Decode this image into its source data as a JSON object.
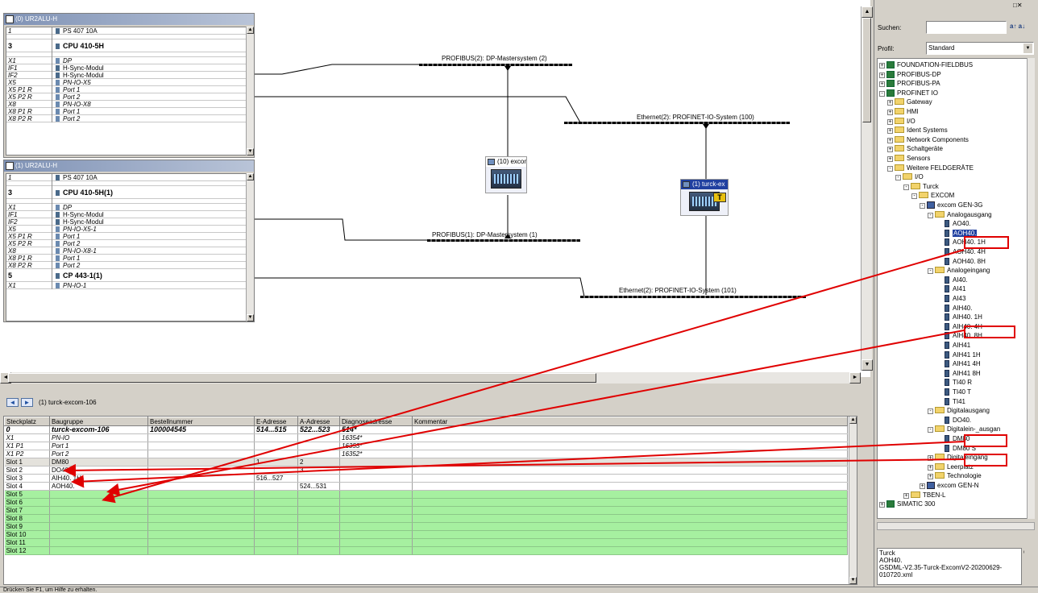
{
  "stations": [
    {
      "title": "(0) UR2ALU-H",
      "rows": [
        {
          "slot": "1",
          "module": "PS 407 10A",
          "type": "normal"
        },
        {
          "slot": "",
          "module": "",
          "type": "spacer"
        },
        {
          "slot": "3",
          "module": "CPU 410-5H",
          "type": "big"
        },
        {
          "slot": "",
          "module": "",
          "type": "spacer"
        },
        {
          "slot": "X1",
          "module": "DP",
          "type": "italic"
        },
        {
          "slot": "IF1",
          "module": "H-Sync-Modul",
          "type": "sub"
        },
        {
          "slot": "IF2",
          "module": "H-Sync-Modul",
          "type": "sub"
        },
        {
          "slot": "X5",
          "module": "PN-IO-X5",
          "type": "italic"
        },
        {
          "slot": "X5 P1 R",
          "module": "Port 1",
          "type": "italic"
        },
        {
          "slot": "X5 P2 R",
          "module": "Port 2",
          "type": "italic"
        },
        {
          "slot": "X8",
          "module": "PN-IO-X8",
          "type": "italic"
        },
        {
          "slot": "X8 P1 R",
          "module": "Port 1",
          "type": "italic"
        },
        {
          "slot": "X8 P2 R",
          "module": "Port 2",
          "type": "italic"
        }
      ]
    },
    {
      "title": "(1) UR2ALU-H",
      "rows": [
        {
          "slot": "1",
          "module": "PS 407 10A",
          "type": "normal"
        },
        {
          "slot": "",
          "module": "",
          "type": "spacer"
        },
        {
          "slot": "3",
          "module": "CPU 410-5H(1)",
          "type": "big"
        },
        {
          "slot": "",
          "module": "",
          "type": "spacer"
        },
        {
          "slot": "X1",
          "module": "DP",
          "type": "italic"
        },
        {
          "slot": "IF1",
          "module": "H-Sync-Modul",
          "type": "sub"
        },
        {
          "slot": "IF2",
          "module": "H-Sync-Modul",
          "type": "sub"
        },
        {
          "slot": "X5",
          "module": "PN-IO-X5-1",
          "type": "italic"
        },
        {
          "slot": "X5 P1 R",
          "module": "Port 1",
          "type": "italic"
        },
        {
          "slot": "X5 P2 R",
          "module": "Port 2",
          "type": "italic"
        },
        {
          "slot": "X8",
          "module": "PN-IO-X8-1",
          "type": "italic"
        },
        {
          "slot": "X8 P1 R",
          "module": "Port 1",
          "type": "italic"
        },
        {
          "slot": "X8 P2 R",
          "module": "Port 2",
          "type": "italic"
        },
        {
          "slot": "5",
          "module": "CP 443-1(1)",
          "type": "boldrow"
        },
        {
          "slot": "X1",
          "module": "PN-IO-1",
          "type": "italic"
        }
      ]
    }
  ],
  "buses": {
    "pb2": "PROFIBUS(2): DP-Mastersystem (2)",
    "pb1": "PROFIBUS(1): DP-Mastersystem (1)",
    "eth2_100": "Ethernet(2): PROFINET-IO-System (100)",
    "eth2_101": "Ethernet(2): PROFINET-IO-System (101)"
  },
  "nodes": {
    "excom": "(10) excom",
    "turck": "(1) turck-ex",
    "badge": "T"
  },
  "detail": {
    "title": "(1)  turck-excom-106",
    "columns": [
      "Steckplatz",
      "Baugruppe",
      "Bestellnummer",
      "E-Adresse",
      "A-Adresse",
      "Diagnoseadresse",
      "Kommentar"
    ],
    "rows": [
      {
        "slot": "0",
        "module": "turck-excom-106",
        "order": "100004545",
        "e": "514...515",
        "a": "522...523",
        "diag": "514*",
        "style": "bold"
      },
      {
        "slot": "X1",
        "module": "PN-IO",
        "order": "",
        "e": "",
        "a": "",
        "diag": "16354*",
        "style": "ital"
      },
      {
        "slot": "X1 P1",
        "module": "Port 1",
        "order": "",
        "e": "",
        "a": "",
        "diag": "16353*",
        "style": "ital"
      },
      {
        "slot": "X1 P2",
        "module": "Port 2",
        "order": "",
        "e": "",
        "a": "",
        "diag": "16352*",
        "style": "ital"
      },
      {
        "slot": "Slot 1",
        "module": "DM80",
        "order": "",
        "e": "1",
        "a": "2",
        "diag": "",
        "style": "sel"
      },
      {
        "slot": "Slot 2",
        "module": "DO40.",
        "order": "",
        "e": "",
        "a": "3",
        "diag": "",
        "style": "normal"
      },
      {
        "slot": "Slot 3",
        "module": "AIH40. 1H",
        "order": "",
        "e": "516...527",
        "a": "",
        "diag": "",
        "style": "normal"
      },
      {
        "slot": "Slot 4",
        "module": "AOH40.",
        "order": "",
        "e": "",
        "a": "524...531",
        "diag": "",
        "style": "normal"
      },
      {
        "slot": "Slot 5",
        "module": "",
        "order": "",
        "e": "",
        "a": "",
        "diag": "",
        "style": "green"
      },
      {
        "slot": "Slot 6",
        "module": "",
        "order": "",
        "e": "",
        "a": "",
        "diag": "",
        "style": "green"
      },
      {
        "slot": "Slot 7",
        "module": "",
        "order": "",
        "e": "",
        "a": "",
        "diag": "",
        "style": "green"
      },
      {
        "slot": "Slot 8",
        "module": "",
        "order": "",
        "e": "",
        "a": "",
        "diag": "",
        "style": "green"
      },
      {
        "slot": "Slot 9",
        "module": "",
        "order": "",
        "e": "",
        "a": "",
        "diag": "",
        "style": "green"
      },
      {
        "slot": "Slot 10",
        "module": "",
        "order": "",
        "e": "",
        "a": "",
        "diag": "",
        "style": "green"
      },
      {
        "slot": "Slot 11",
        "module": "",
        "order": "",
        "e": "",
        "a": "",
        "diag": "",
        "style": "green"
      },
      {
        "slot": "Slot 12",
        "module": "",
        "order": "",
        "e": "",
        "a": "",
        "diag": "",
        "style": "green"
      }
    ]
  },
  "catalog": {
    "search_label": "Suchen:",
    "search_value": "",
    "profile_label": "Profil:",
    "profile_value": "Standard",
    "tree": [
      {
        "d": 0,
        "pm": "+",
        "ic": "net",
        "t": "FOUNDATION-FIELDBUS"
      },
      {
        "d": 0,
        "pm": "+",
        "ic": "net",
        "t": "PROFIBUS-DP"
      },
      {
        "d": 0,
        "pm": "+",
        "ic": "net",
        "t": "PROFIBUS-PA"
      },
      {
        "d": 0,
        "pm": "-",
        "ic": "net",
        "t": "PROFINET IO"
      },
      {
        "d": 1,
        "pm": "+",
        "ic": "fold",
        "t": "Gateway"
      },
      {
        "d": 1,
        "pm": "+",
        "ic": "fold",
        "t": "HMI"
      },
      {
        "d": 1,
        "pm": "+",
        "ic": "fold",
        "t": "I/O"
      },
      {
        "d": 1,
        "pm": "+",
        "ic": "fold",
        "t": "Ident Systems"
      },
      {
        "d": 1,
        "pm": "+",
        "ic": "fold",
        "t": "Network Components"
      },
      {
        "d": 1,
        "pm": "+",
        "ic": "fold",
        "t": "Schaltgeräte"
      },
      {
        "d": 1,
        "pm": "+",
        "ic": "fold",
        "t": "Sensors"
      },
      {
        "d": 1,
        "pm": "-",
        "ic": "fold",
        "t": "Weitere FELDGERÄTE"
      },
      {
        "d": 2,
        "pm": "-",
        "ic": "fold",
        "t": "I/O"
      },
      {
        "d": 3,
        "pm": "-",
        "ic": "fold",
        "t": "Turck"
      },
      {
        "d": 4,
        "pm": "-",
        "ic": "fold",
        "t": "EXCOM"
      },
      {
        "d": 5,
        "pm": "-",
        "ic": "dev",
        "t": "excom GEN-3G"
      },
      {
        "d": 6,
        "pm": "-",
        "ic": "fold",
        "t": "Analogausgang"
      },
      {
        "d": 7,
        "pm": "",
        "ic": "mod",
        "t": "AO40."
      },
      {
        "d": 7,
        "pm": "",
        "ic": "mod",
        "t": "AOH40.",
        "sel": true
      },
      {
        "d": 7,
        "pm": "",
        "ic": "mod",
        "t": "AOH40. 1H"
      },
      {
        "d": 7,
        "pm": "",
        "ic": "mod",
        "t": "AOH40. 4H"
      },
      {
        "d": 7,
        "pm": "",
        "ic": "mod",
        "t": "AOH40. 8H"
      },
      {
        "d": 6,
        "pm": "-",
        "ic": "fold",
        "t": "Analogeingang"
      },
      {
        "d": 7,
        "pm": "",
        "ic": "mod",
        "t": "AI40."
      },
      {
        "d": 7,
        "pm": "",
        "ic": "mod",
        "t": "AI41"
      },
      {
        "d": 7,
        "pm": "",
        "ic": "mod",
        "t": "AI43"
      },
      {
        "d": 7,
        "pm": "",
        "ic": "mod",
        "t": "AIH40."
      },
      {
        "d": 7,
        "pm": "",
        "ic": "mod",
        "t": "AIH40. 1H"
      },
      {
        "d": 7,
        "pm": "",
        "ic": "mod",
        "t": "AIH40. 4H"
      },
      {
        "d": 7,
        "pm": "",
        "ic": "mod",
        "t": "AIH40. 8H"
      },
      {
        "d": 7,
        "pm": "",
        "ic": "mod",
        "t": "AIH41"
      },
      {
        "d": 7,
        "pm": "",
        "ic": "mod",
        "t": "AIH41 1H"
      },
      {
        "d": 7,
        "pm": "",
        "ic": "mod",
        "t": "AIH41 4H"
      },
      {
        "d": 7,
        "pm": "",
        "ic": "mod",
        "t": "AIH41 8H"
      },
      {
        "d": 7,
        "pm": "",
        "ic": "mod",
        "t": "TI40 R"
      },
      {
        "d": 7,
        "pm": "",
        "ic": "mod",
        "t": "TI40 T"
      },
      {
        "d": 7,
        "pm": "",
        "ic": "mod",
        "t": "TI41"
      },
      {
        "d": 6,
        "pm": "-",
        "ic": "fold",
        "t": "Digitalausgang"
      },
      {
        "d": 7,
        "pm": "",
        "ic": "mod",
        "t": "DO40."
      },
      {
        "d": 6,
        "pm": "-",
        "ic": "fold",
        "t": "Digitalein-_ausgan"
      },
      {
        "d": 7,
        "pm": "",
        "ic": "mod",
        "t": "DM80"
      },
      {
        "d": 7,
        "pm": "",
        "ic": "mod",
        "t": "DM80 S"
      },
      {
        "d": 6,
        "pm": "+",
        "ic": "fold",
        "t": "Digitaleingang"
      },
      {
        "d": 6,
        "pm": "+",
        "ic": "fold",
        "t": "Leerplatz"
      },
      {
        "d": 6,
        "pm": "+",
        "ic": "fold",
        "t": "Technologie"
      },
      {
        "d": 5,
        "pm": "+",
        "ic": "dev",
        "t": "excom GEN-N"
      },
      {
        "d": 3,
        "pm": "+",
        "ic": "fold",
        "t": "TBEN-L"
      },
      {
        "d": 0,
        "pm": "+",
        "ic": "net",
        "t": "SIMATIC 300"
      }
    ],
    "info_lines": [
      "Turck",
      "AOH40.",
      "GSDML-V2.35-Turck-ExcomV2-20200629-",
      "010720.xml"
    ]
  },
  "status": "Drücken Sie F1, um Hilfe zu erhalten."
}
